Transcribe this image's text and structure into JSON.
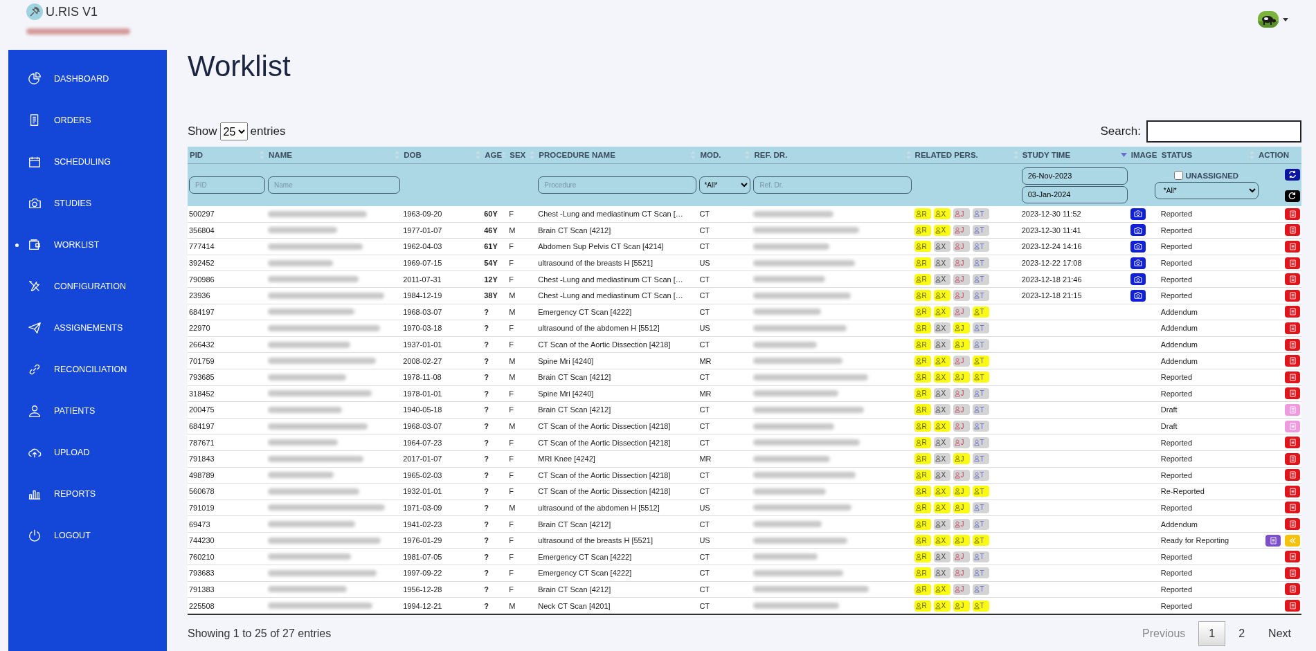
{
  "app": {
    "title": "U.RIS V1"
  },
  "sidebar": {
    "items": [
      {
        "label": "DASHBOARD",
        "selected": false
      },
      {
        "label": "ORDERS",
        "selected": false
      },
      {
        "label": "SCHEDULING",
        "selected": false
      },
      {
        "label": "STUDIES",
        "selected": false
      },
      {
        "label": "WORKLIST",
        "selected": true
      },
      {
        "label": "CONFIGURATION",
        "selected": false
      },
      {
        "label": "ASSIGNEMENTS",
        "selected": false
      },
      {
        "label": "RECONCILIATION",
        "selected": false
      },
      {
        "label": "PATIENTS",
        "selected": false
      },
      {
        "label": "UPLOAD",
        "selected": false
      },
      {
        "label": "REPORTS",
        "selected": false
      },
      {
        "label": "LOGOUT",
        "selected": false
      }
    ]
  },
  "page": {
    "title": "Worklist"
  },
  "length": {
    "prefix": "Show",
    "value": "25",
    "suffix": "entries"
  },
  "search": {
    "label": "Search:"
  },
  "table": {
    "columns": [
      {
        "label": "PID",
        "sortable": true,
        "sorted": false
      },
      {
        "label": "NAME",
        "sortable": true,
        "sorted": false
      },
      {
        "label": "DOB",
        "sortable": true,
        "sorted": false
      },
      {
        "label": "AGE",
        "sortable": true,
        "sorted": false
      },
      {
        "label": "SEX",
        "sortable": true,
        "sorted": false
      },
      {
        "label": "PROCEDURE NAME",
        "sortable": true,
        "sorted": false
      },
      {
        "label": "MOD.",
        "sortable": true,
        "sorted": false
      },
      {
        "label": "REF. DR.",
        "sortable": true,
        "sorted": false
      },
      {
        "label": "RELATED PERS.",
        "sortable": true,
        "sorted": false
      },
      {
        "label": "STUDY TIME",
        "sortable": true,
        "sorted": true
      },
      {
        "label": "IMAGE",
        "sortable": false,
        "sorted": false
      },
      {
        "label": "STATUS",
        "sortable": true,
        "sorted": false
      },
      {
        "label": "ACTION",
        "sortable": false,
        "sorted": false
      }
    ],
    "filters": {
      "pid_placeholder": "PID",
      "name_placeholder": "Name",
      "procedure_placeholder": "Procedure",
      "modality": "*All*",
      "ref_placeholder": "Ref. Dr.",
      "date_from": "26-Nov-2023",
      "date_to": "03-Jan-2024",
      "unassigned_label": "UNASSIGNED",
      "unassigned": false,
      "status": "*All*"
    },
    "rows": [
      {
        "pid": "500297",
        "dob": "1963-09-20",
        "age": "60Y",
        "sex": "F",
        "procedure": "Chest -Lung and mediastinum CT Scan […",
        "modality": "CT",
        "persons": [
          {
            "label": "R",
            "on": true
          },
          {
            "label": "X",
            "on": true
          },
          {
            "label": "J",
            "on": false
          },
          {
            "label": "T",
            "on": false
          }
        ],
        "study_time": "2023-12-30 11:52",
        "image": true,
        "status": "Reported",
        "kind": "report"
      },
      {
        "pid": "356804",
        "dob": "1977-01-07",
        "age": "46Y",
        "sex": "M",
        "procedure": "Brain CT Scan [4212]",
        "modality": "CT",
        "persons": [
          {
            "label": "R",
            "on": true
          },
          {
            "label": "X",
            "on": true
          },
          {
            "label": "J",
            "on": false
          },
          {
            "label": "T",
            "on": false
          }
        ],
        "study_time": "2023-12-30 11:41",
        "image": true,
        "status": "Reported",
        "kind": "report"
      },
      {
        "pid": "777414",
        "dob": "1962-04-03",
        "age": "61Y",
        "sex": "F",
        "procedure": "Abdomen Sup Pelvis CT Scan [4214]",
        "modality": "CT",
        "persons": [
          {
            "label": "R",
            "on": true
          },
          {
            "label": "X",
            "on": false
          },
          {
            "label": "J",
            "on": false
          },
          {
            "label": "T",
            "on": false
          }
        ],
        "study_time": "2023-12-24 14:16",
        "image": true,
        "status": "Reported",
        "kind": "report"
      },
      {
        "pid": "392452",
        "dob": "1969-07-15",
        "age": "54Y",
        "sex": "F",
        "procedure": "ultrasound of the breasts H [5521]",
        "modality": "US",
        "persons": [
          {
            "label": "R",
            "on": true
          },
          {
            "label": "X",
            "on": false
          },
          {
            "label": "J",
            "on": false
          },
          {
            "label": "T",
            "on": false
          }
        ],
        "study_time": "2023-12-22 17:08",
        "image": true,
        "status": "Reported",
        "kind": "report"
      },
      {
        "pid": "790986",
        "dob": "2011-07-31",
        "age": "12Y",
        "sex": "F",
        "procedure": "Chest -Lung and mediastinum CT Scan […",
        "modality": "CT",
        "persons": [
          {
            "label": "R",
            "on": true
          },
          {
            "label": "X",
            "on": false
          },
          {
            "label": "J",
            "on": false
          },
          {
            "label": "T",
            "on": false
          }
        ],
        "study_time": "2023-12-18 21:46",
        "image": true,
        "status": "Reported",
        "kind": "report"
      },
      {
        "pid": "23936",
        "dob": "1984-12-19",
        "age": "38Y",
        "sex": "M",
        "procedure": "Chest -Lung and mediastinum CT Scan […",
        "modality": "CT",
        "persons": [
          {
            "label": "R",
            "on": true
          },
          {
            "label": "X",
            "on": true
          },
          {
            "label": "J",
            "on": false
          },
          {
            "label": "T",
            "on": false
          }
        ],
        "study_time": "2023-12-18 21:15",
        "image": true,
        "status": "Reported",
        "kind": "report"
      },
      {
        "pid": "684197",
        "dob": "1968-03-07",
        "age": "?",
        "sex": "M",
        "procedure": "Emergency CT Scan [4222]",
        "modality": "CT",
        "persons": [
          {
            "label": "R",
            "on": true
          },
          {
            "label": "X",
            "on": true
          },
          {
            "label": "J",
            "on": false
          },
          {
            "label": "T",
            "on": true
          }
        ],
        "image": false,
        "status": "Addendum",
        "kind": "report"
      },
      {
        "pid": "22970",
        "dob": "1970-03-18",
        "age": "?",
        "sex": "F",
        "procedure": "ultrasound of the abdomen H [5512]",
        "modality": "US",
        "persons": [
          {
            "label": "R",
            "on": true
          },
          {
            "label": "X",
            "on": false
          },
          {
            "label": "J",
            "on": true
          },
          {
            "label": "T",
            "on": false
          }
        ],
        "image": false,
        "status": "Addendum",
        "kind": "report"
      },
      {
        "pid": "266432",
        "dob": "1937-01-01",
        "age": "?",
        "sex": "F",
        "procedure": "CT Scan of the Aortic Dissection [4218]",
        "modality": "CT",
        "persons": [
          {
            "label": "R",
            "on": true
          },
          {
            "label": "X",
            "on": false
          },
          {
            "label": "J",
            "on": true
          },
          {
            "label": "T",
            "on": false
          }
        ],
        "image": false,
        "status": "Addendum",
        "kind": "report"
      },
      {
        "pid": "701759",
        "dob": "2008-02-27",
        "age": "?",
        "sex": "M",
        "procedure": "Spine Mri [4240]",
        "modality": "MR",
        "persons": [
          {
            "label": "R",
            "on": true
          },
          {
            "label": "X",
            "on": true
          },
          {
            "label": "J",
            "on": false
          },
          {
            "label": "T",
            "on": true
          }
        ],
        "image": false,
        "status": "Addendum",
        "kind": "report"
      },
      {
        "pid": "793685",
        "dob": "1978-11-08",
        "age": "?",
        "sex": "M",
        "procedure": "Brain CT Scan [4212]",
        "modality": "CT",
        "persons": [
          {
            "label": "R",
            "on": true
          },
          {
            "label": "X",
            "on": true
          },
          {
            "label": "J",
            "on": true
          },
          {
            "label": "T",
            "on": true
          }
        ],
        "image": false,
        "status": "Reported",
        "kind": "report"
      },
      {
        "pid": "318452",
        "dob": "1978-01-01",
        "age": "?",
        "sex": "F",
        "procedure": "Spine Mri [4240]",
        "modality": "MR",
        "persons": [
          {
            "label": "R",
            "on": true
          },
          {
            "label": "X",
            "on": false
          },
          {
            "label": "J",
            "on": false
          },
          {
            "label": "T",
            "on": false
          }
        ],
        "image": false,
        "status": "Reported",
        "kind": "report"
      },
      {
        "pid": "200475",
        "dob": "1940-05-18",
        "age": "?",
        "sex": "F",
        "procedure": "Brain CT Scan [4212]",
        "modality": "CT",
        "persons": [
          {
            "label": "R",
            "on": true
          },
          {
            "label": "X",
            "on": false
          },
          {
            "label": "J",
            "on": false
          },
          {
            "label": "T",
            "on": false
          }
        ],
        "image": false,
        "status": "Draft",
        "kind": "draft"
      },
      {
        "pid": "684197",
        "dob": "1968-03-07",
        "age": "?",
        "sex": "M",
        "procedure": "CT Scan of the Aortic Dissection [4218]",
        "modality": "CT",
        "persons": [
          {
            "label": "R",
            "on": true
          },
          {
            "label": "X",
            "on": true
          },
          {
            "label": "J",
            "on": false
          },
          {
            "label": "T",
            "on": false
          }
        ],
        "image": false,
        "status": "Draft",
        "kind": "draft"
      },
      {
        "pid": "787671",
        "dob": "1964-07-23",
        "age": "?",
        "sex": "F",
        "procedure": "CT Scan of the Aortic Dissection [4218]",
        "modality": "CT",
        "persons": [
          {
            "label": "R",
            "on": true
          },
          {
            "label": "X",
            "on": false
          },
          {
            "label": "J",
            "on": false
          },
          {
            "label": "T",
            "on": false
          }
        ],
        "image": false,
        "status": "Reported",
        "kind": "report"
      },
      {
        "pid": "791843",
        "dob": "2017-01-07",
        "age": "?",
        "sex": "F",
        "procedure": "MRI Knee [4242]",
        "modality": "MR",
        "persons": [
          {
            "label": "R",
            "on": true
          },
          {
            "label": "X",
            "on": false
          },
          {
            "label": "J",
            "on": true
          },
          {
            "label": "T",
            "on": false
          }
        ],
        "image": false,
        "status": "Reported",
        "kind": "report"
      },
      {
        "pid": "498789",
        "dob": "1965-02-03",
        "age": "?",
        "sex": "F",
        "procedure": "CT Scan of the Aortic Dissection [4218]",
        "modality": "CT",
        "persons": [
          {
            "label": "R",
            "on": true
          },
          {
            "label": "X",
            "on": false
          },
          {
            "label": "J",
            "on": false
          },
          {
            "label": "T",
            "on": false
          }
        ],
        "image": false,
        "status": "Reported",
        "kind": "report"
      },
      {
        "pid": "560678",
        "dob": "1932-01-01",
        "age": "?",
        "sex": "F",
        "procedure": "CT Scan of the Aortic Dissection [4218]",
        "modality": "CT",
        "persons": [
          {
            "label": "R",
            "on": true
          },
          {
            "label": "X",
            "on": true
          },
          {
            "label": "J",
            "on": true
          },
          {
            "label": "T",
            "on": true
          }
        ],
        "image": false,
        "status": "Re-Reported",
        "kind": "report"
      },
      {
        "pid": "791019",
        "dob": "1971-03-09",
        "age": "?",
        "sex": "M",
        "procedure": "ultrasound of the abdomen H [5512]",
        "modality": "US",
        "persons": [
          {
            "label": "R",
            "on": true
          },
          {
            "label": "X",
            "on": true
          },
          {
            "label": "J",
            "on": true
          },
          {
            "label": "T",
            "on": false
          }
        ],
        "image": false,
        "status": "Reported",
        "kind": "report"
      },
      {
        "pid": "69473",
        "dob": "1941-02-23",
        "age": "?",
        "sex": "F",
        "procedure": "Brain CT Scan [4212]",
        "modality": "CT",
        "persons": [
          {
            "label": "R",
            "on": true
          },
          {
            "label": "X",
            "on": false
          },
          {
            "label": "J",
            "on": false
          },
          {
            "label": "T",
            "on": false
          }
        ],
        "image": false,
        "status": "Addendum",
        "kind": "report"
      },
      {
        "pid": "744230",
        "dob": "1976-01-29",
        "age": "?",
        "sex": "F",
        "procedure": "ultrasound of the breasts H [5521]",
        "modality": "US",
        "persons": [
          {
            "label": "R",
            "on": true
          },
          {
            "label": "X",
            "on": true
          },
          {
            "label": "J",
            "on": true
          },
          {
            "label": "T",
            "on": true
          }
        ],
        "image": false,
        "status": "Ready for Reporting",
        "kind": "ready"
      },
      {
        "pid": "760210",
        "dob": "1981-07-05",
        "age": "?",
        "sex": "F",
        "procedure": "Emergency CT Scan [4222]",
        "modality": "CT",
        "persons": [
          {
            "label": "R",
            "on": true
          },
          {
            "label": "X",
            "on": false
          },
          {
            "label": "J",
            "on": false
          },
          {
            "label": "T",
            "on": false
          }
        ],
        "image": false,
        "status": "Reported",
        "kind": "report"
      },
      {
        "pid": "793683",
        "dob": "1997-09-22",
        "age": "?",
        "sex": "F",
        "procedure": "Emergency CT Scan [4222]",
        "modality": "CT",
        "persons": [
          {
            "label": "R",
            "on": true
          },
          {
            "label": "X",
            "on": false
          },
          {
            "label": "J",
            "on": false
          },
          {
            "label": "T",
            "on": false
          }
        ],
        "image": false,
        "status": "Reported",
        "kind": "report"
      },
      {
        "pid": "791383",
        "dob": "1956-12-28",
        "age": "?",
        "sex": "F",
        "procedure": "Brain CT Scan [4212]",
        "modality": "CT",
        "persons": [
          {
            "label": "R",
            "on": true
          },
          {
            "label": "X",
            "on": true
          },
          {
            "label": "J",
            "on": false
          },
          {
            "label": "T",
            "on": false
          }
        ],
        "image": false,
        "status": "Reported",
        "kind": "report"
      },
      {
        "pid": "225508",
        "dob": "1994-12-21",
        "age": "?",
        "sex": "M",
        "procedure": "Neck CT Scan [4201]",
        "modality": "CT",
        "persons": [
          {
            "label": "R",
            "on": true
          },
          {
            "label": "X",
            "on": true
          },
          {
            "label": "J",
            "on": true
          },
          {
            "label": "T",
            "on": true
          }
        ],
        "image": false,
        "status": "Reported",
        "kind": "report"
      }
    ]
  },
  "footer": {
    "info": "Showing 1 to 25 of 27 entries",
    "previous": {
      "label": "Previous",
      "disabled": true
    },
    "pages": [
      {
        "label": "1",
        "selected": true
      },
      {
        "label": "2",
        "selected": false
      }
    ],
    "next": {
      "label": "Next",
      "disabled": false
    }
  }
}
